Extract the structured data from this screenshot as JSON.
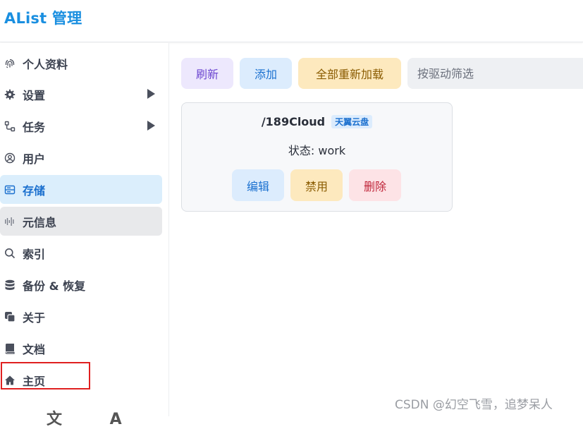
{
  "header": {
    "brand": "AList 管理"
  },
  "sidebar": {
    "items": [
      {
        "label": "个人资料",
        "icon": "fingerprint-icon"
      },
      {
        "label": "设置",
        "icon": "gear-icon",
        "expandable": true
      },
      {
        "label": "任务",
        "icon": "flow-icon",
        "expandable": true
      },
      {
        "label": "用户",
        "icon": "user-circle-icon"
      },
      {
        "label": "存储",
        "icon": "storage-icon",
        "active": true
      },
      {
        "label": "元信息",
        "icon": "meta-icon"
      },
      {
        "label": "索引",
        "icon": "search-icon"
      },
      {
        "label": "备份 & 恢复",
        "icon": "database-icon"
      },
      {
        "label": "关于",
        "icon": "copy-icon"
      },
      {
        "label": "文档",
        "icon": "book-icon"
      },
      {
        "label": "主页",
        "icon": "home-icon"
      }
    ],
    "footer_partial": "文 A"
  },
  "toolbar": {
    "refresh": "刷新",
    "add": "添加",
    "reload_all": "全部重新加载",
    "filter_placeholder": "按驱动筛选"
  },
  "storage_card": {
    "mount_path": "/189Cloud",
    "driver": "天翼云盘",
    "status": "状态: work",
    "edit": "编辑",
    "disable": "禁用",
    "delete": "删除"
  },
  "watermark": "CSDN @幻空飞雪，追梦呆人",
  "colors": {
    "brand": "#1a8fe0",
    "active_bg": "#dbeefc",
    "highlight_border": "#e02020"
  }
}
